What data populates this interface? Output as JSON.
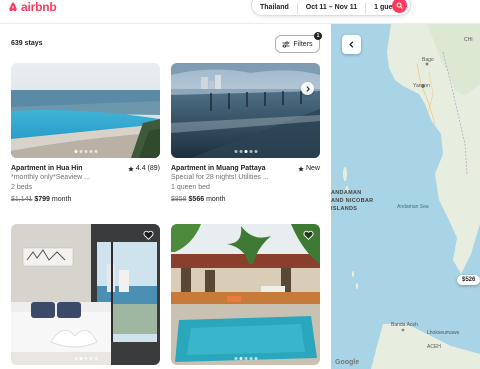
{
  "brand": {
    "name": "airbnb",
    "color": "#ff385c",
    "icon": "airbnb-logo-icon"
  },
  "search": {
    "location": "Thailand",
    "dates": "Oct 11 – Nov 11",
    "guests": "1 guest",
    "search_icon": "search-icon"
  },
  "results": {
    "count_label": "639 stays"
  },
  "filters": {
    "label": "Filters",
    "badge": "1",
    "icon": "sliders-icon"
  },
  "listings": [
    {
      "title": "Apartment in Hua Hin",
      "rating": "4.4 (89)",
      "desc": "*monthly only*Seaview ...",
      "detail": "2 beds",
      "old_price": "$1,141",
      "price": "$799",
      "period": "month",
      "active_dot": 0
    },
    {
      "title": "Apartment in Muang Pattaya",
      "rating": "New",
      "desc": "Special for 28 nights! Utilities ...",
      "detail": "1 queen bed",
      "old_price": "$858",
      "price": "$566",
      "period": "month",
      "active_dot": 2
    },
    {
      "active_dot": 1
    },
    {
      "active_dot": 1
    }
  ],
  "map": {
    "labels": [
      "Bago",
      "Yangon",
      "CHI",
      "ANDAMAN",
      "AND NICOBAR",
      "ISLANDS",
      "Andaman Sea",
      "Banda Aceh",
      "Lhokseumawe",
      "ACEH"
    ],
    "markers": [
      "$526"
    ],
    "attribution": "Google",
    "colors": {
      "water": "#a9d4e6",
      "land": "#e7eedf"
    }
  }
}
